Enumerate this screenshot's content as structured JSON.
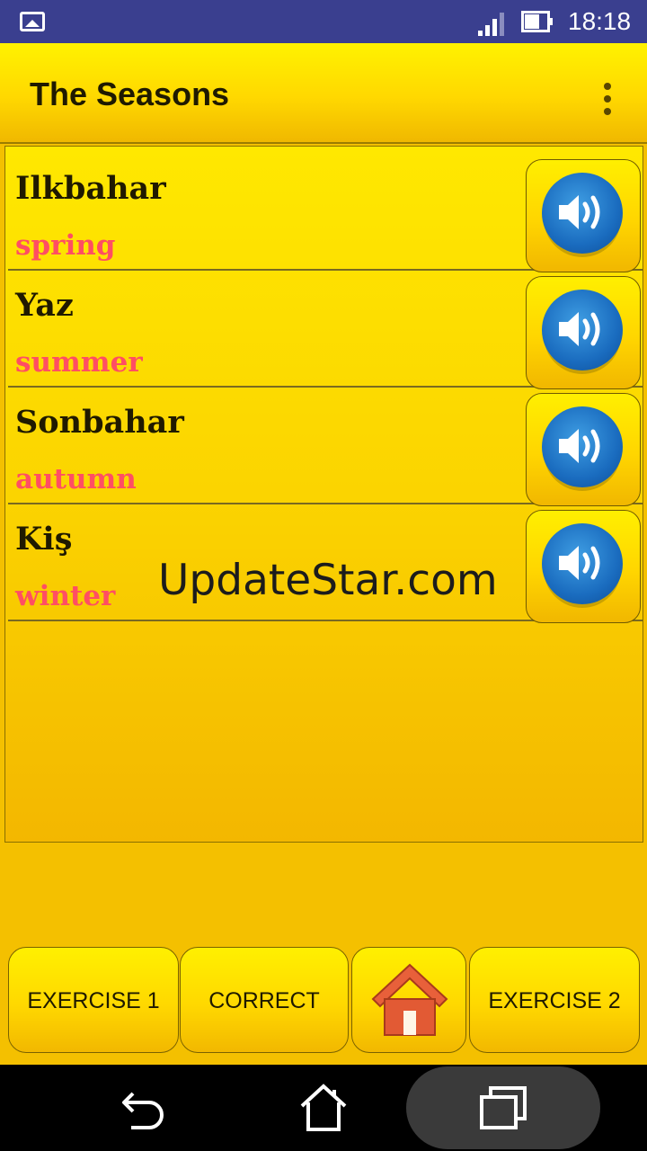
{
  "status_bar": {
    "time": "18:18",
    "icons": [
      "gallery-icon",
      "signal-icon",
      "battery-icon"
    ]
  },
  "app_bar": {
    "title": "The Seasons",
    "menu_icon": "overflow-menu-icon"
  },
  "words": [
    {
      "word": "Ilkbahar",
      "meaning": "spring"
    },
    {
      "word": "Yaz",
      "meaning": "summer"
    },
    {
      "word": "Sonbahar",
      "meaning": "autumn"
    },
    {
      "word": "Kiş",
      "meaning": "winter"
    }
  ],
  "watermark": "UpdateStar.com",
  "buttons": {
    "exercise1": "EXERCISE 1",
    "correct": "CORRECT",
    "home_icon": "home-icon",
    "exercise2": "EXERCISE 2"
  },
  "nav_bar": {
    "icons": [
      "back-icon",
      "home-icon",
      "recent-apps-icon"
    ]
  },
  "colors": {
    "status_bar": "#3a3f8f",
    "panel": "#f4c000",
    "meaning_text": "#ff4e63",
    "speaker_blue": "#1a6cbf"
  }
}
